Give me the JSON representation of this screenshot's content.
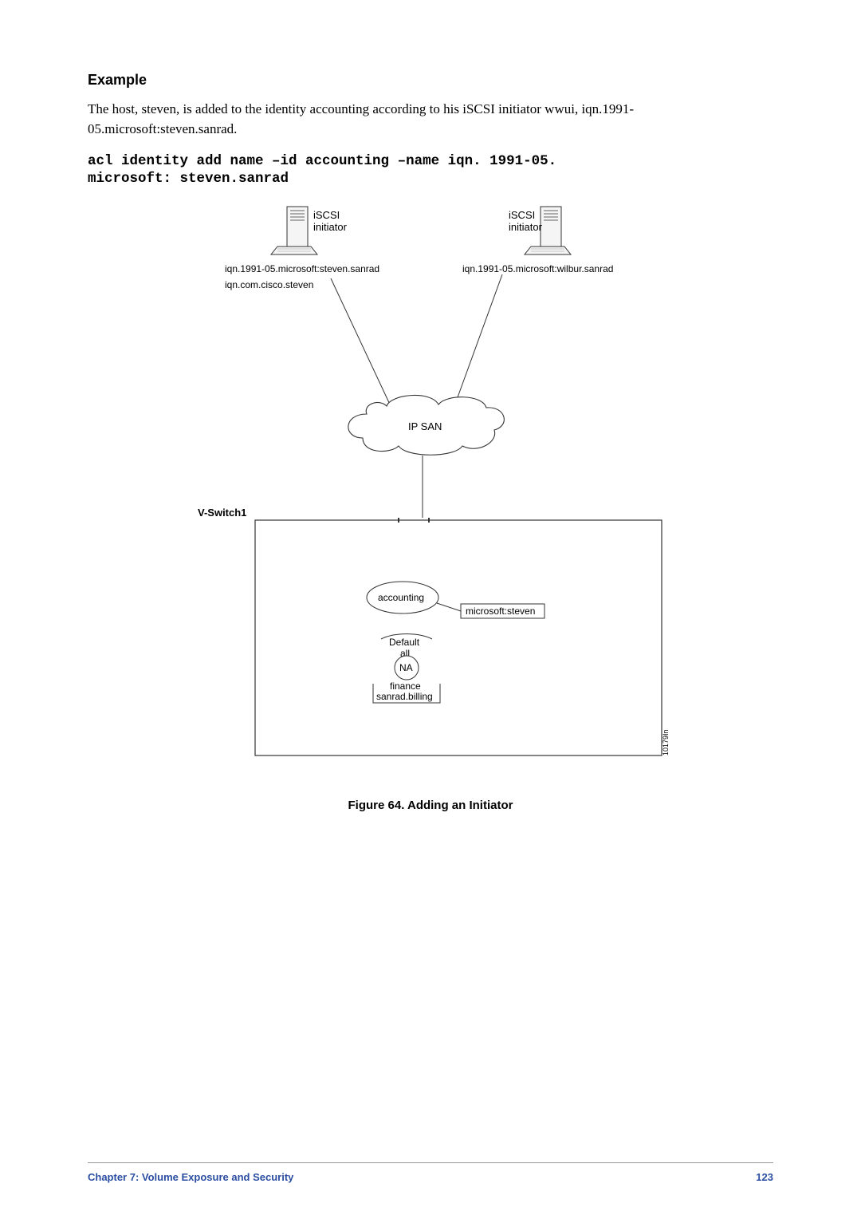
{
  "example_heading": "Example",
  "body_text": "The host, steven, is added to the identity accounting according to his iSCSI initiator wwui, iqn.1991-05.microsoft:steven.sanrad.",
  "code": {
    "line1": "acl identity add name –id accounting –name iqn. 1991-05.",
    "line2": "microsoft: steven.sanrad"
  },
  "diagram": {
    "host1": {
      "label": "iSCSI\ninitiator",
      "iqn1": "iqn.1991-05.microsoft:steven.sanrad",
      "iqn2": "iqn.com.cisco.steven"
    },
    "host2": {
      "label": "iSCSI\ninitiator",
      "iqn1": "iqn.1991-05.microsoft:wilbur.sanrad"
    },
    "cloud_label": "IP SAN",
    "switch_label": "V-Switch1",
    "identity_node": "accounting",
    "identity_tag": "microsoft:steven",
    "default_label": "Default",
    "default_all": "all",
    "na": "NA",
    "finance_label": "finance",
    "billing_label": "sanrad.billing",
    "side_code": "10179In"
  },
  "figure_caption": "Figure 64.      Adding an Initiator",
  "footer": {
    "chapter": "Chapter 7:  Volume Exposure and Security",
    "page": "123"
  }
}
